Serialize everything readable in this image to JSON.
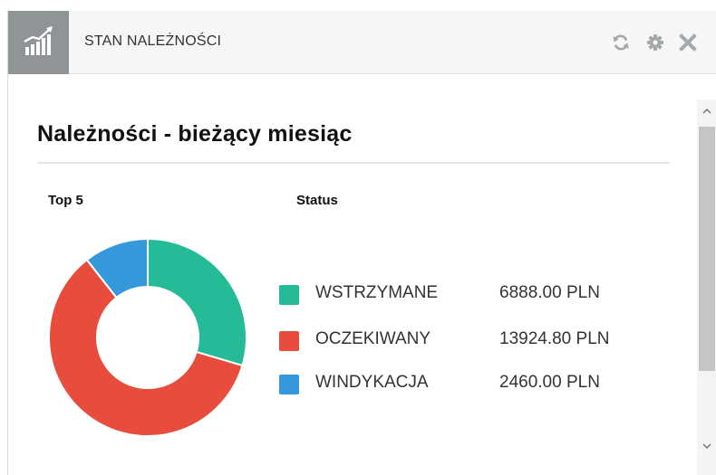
{
  "widget": {
    "title": "STAN NALEŻNOŚCI",
    "icon": "bar-chart-trend-icon",
    "actions": [
      {
        "name": "refresh-icon"
      },
      {
        "name": "gear-icon"
      },
      {
        "name": "close-icon"
      }
    ]
  },
  "main": {
    "title": "Należności - bieżący miesiąc",
    "top_label": "Top 5",
    "status_label": "Status"
  },
  "colors": {
    "teal": "#26bb98",
    "red": "#e74c3c",
    "blue": "#3498db",
    "header_icon_bg": "#8f9597",
    "header_icon_fg": "#ffffff",
    "action_icon": "#a3a8ab"
  },
  "legend": [
    {
      "label": "WSTRZYMANE",
      "value": "6888.00 PLN"
    },
    {
      "label": "OCZEKIWANY",
      "value": "13924.80 PLN"
    },
    {
      "label": "WINDYKACJA",
      "value": "2460.00 PLN"
    }
  ],
  "chart_data": {
    "type": "pie",
    "donut": true,
    "categories": [
      "WSTRZYMANE",
      "OCZEKIWANY",
      "WINDYKACJA"
    ],
    "values": [
      6888.0,
      13924.8,
      2460.0
    ],
    "colors": [
      "#26bb98",
      "#e74c3c",
      "#3498db"
    ],
    "legend": "right"
  }
}
